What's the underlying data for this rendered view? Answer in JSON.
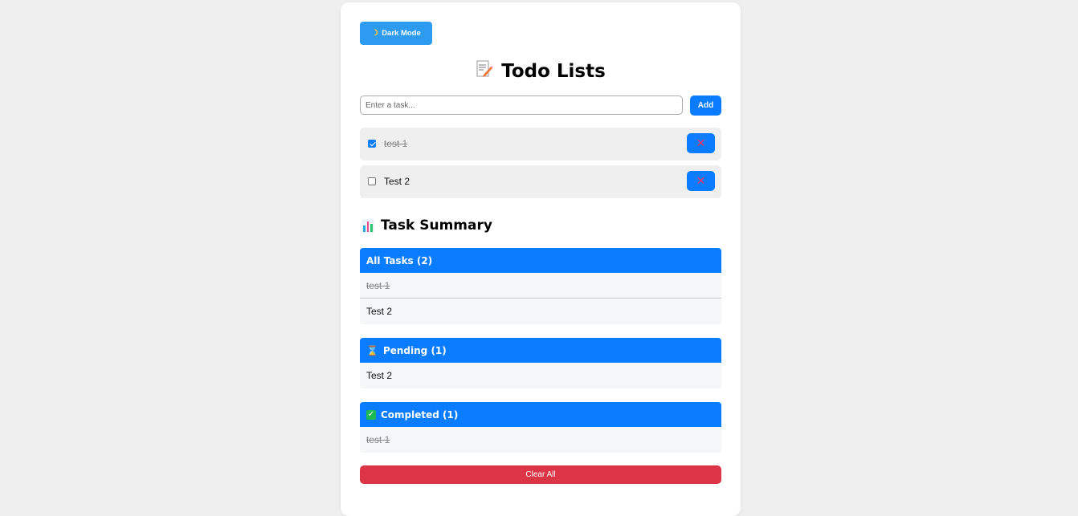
{
  "header": {
    "dark_mode_label": "Dark Mode",
    "dark_mode_icon": "moon-icon",
    "title": "Todo Lists",
    "title_icon": "memo-icon"
  },
  "input": {
    "placeholder": "Enter a task...",
    "value": "",
    "add_label": "Add"
  },
  "todos": [
    {
      "text": "test 1",
      "completed": true
    },
    {
      "text": "Test 2",
      "completed": false
    }
  ],
  "summary": {
    "title": "Task Summary",
    "title_icon": "bar-chart-icon",
    "all": {
      "label": "All Tasks (2)",
      "items": [
        "test 1",
        "Test 2"
      ]
    },
    "pending": {
      "label": "Pending (1)",
      "icon": "hourglass-icon",
      "items": [
        "Test 2"
      ]
    },
    "completed": {
      "label": "Completed (1)",
      "icon": "check-icon",
      "items": [
        "test 1"
      ]
    }
  },
  "clear_all_label": "Clear All",
  "colors": {
    "primary": "#0a7cff",
    "dark_mode_button": "#2d9bf0",
    "danger": "#dc3545",
    "delete_icon": "#f0345e"
  }
}
